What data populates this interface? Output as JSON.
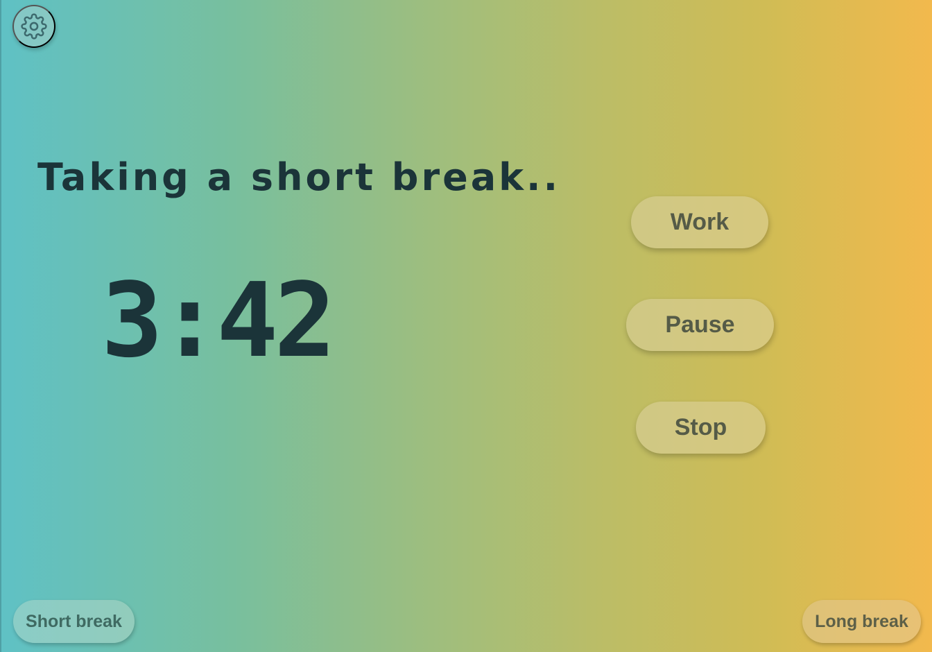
{
  "settings": {
    "icon": "gear-icon"
  },
  "session": {
    "status": "Taking a short break..",
    "time_remaining": "3:42"
  },
  "controls": {
    "work_label": "Work",
    "pause_label": "Pause",
    "stop_label": "Stop"
  },
  "presets": {
    "short_break_label": "Short break",
    "long_break_label": "Long break"
  },
  "colors": {
    "gradient_start": "#5fc1c5",
    "gradient_end": "#f2b94d",
    "text_dark": "#1b3439",
    "button_text": "#555b47"
  }
}
